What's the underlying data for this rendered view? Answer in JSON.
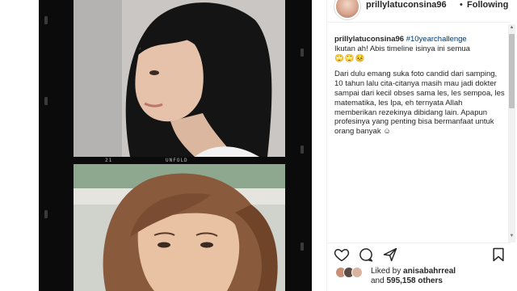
{
  "post": {
    "username": "prillylatuconsina96",
    "separator": "•",
    "follow_status": "Following"
  },
  "media": {
    "film_frame_label": "21",
    "film_brand": "UNFOLD"
  },
  "caption": {
    "author": "prillylatuconsina96",
    "hashtag": "#10yearchallenge",
    "line1": "Ikutan ah! Abis timeline isinya ini semua",
    "line1_emoji": "🙄🙄😣",
    "paragraph": "Dari dulu emang suka foto candid dari samping, 10 tahun lalu cita-citanya masih mau jadi dokter sampai dari kecil obses sama les, les sempoa, les matematika, les Ipa, eh ternyata Allah memberikan rezekinya dibidang lain. Apapun profesinya yang penting bisa bermanfaat untuk orang banyak",
    "paragraph_emoji": "☺"
  },
  "actions": {
    "like_icon": "heart-icon",
    "comment_icon": "comment-icon",
    "share_icon": "share-icon",
    "save_icon": "bookmark-icon"
  },
  "likes": {
    "prefix": "Liked by",
    "liker": "anisabahrreal",
    "conjunction": "and",
    "count": "595,158 others"
  },
  "colors": {
    "text": "#262626",
    "hashtag": "#003569",
    "border": "#efefef"
  }
}
